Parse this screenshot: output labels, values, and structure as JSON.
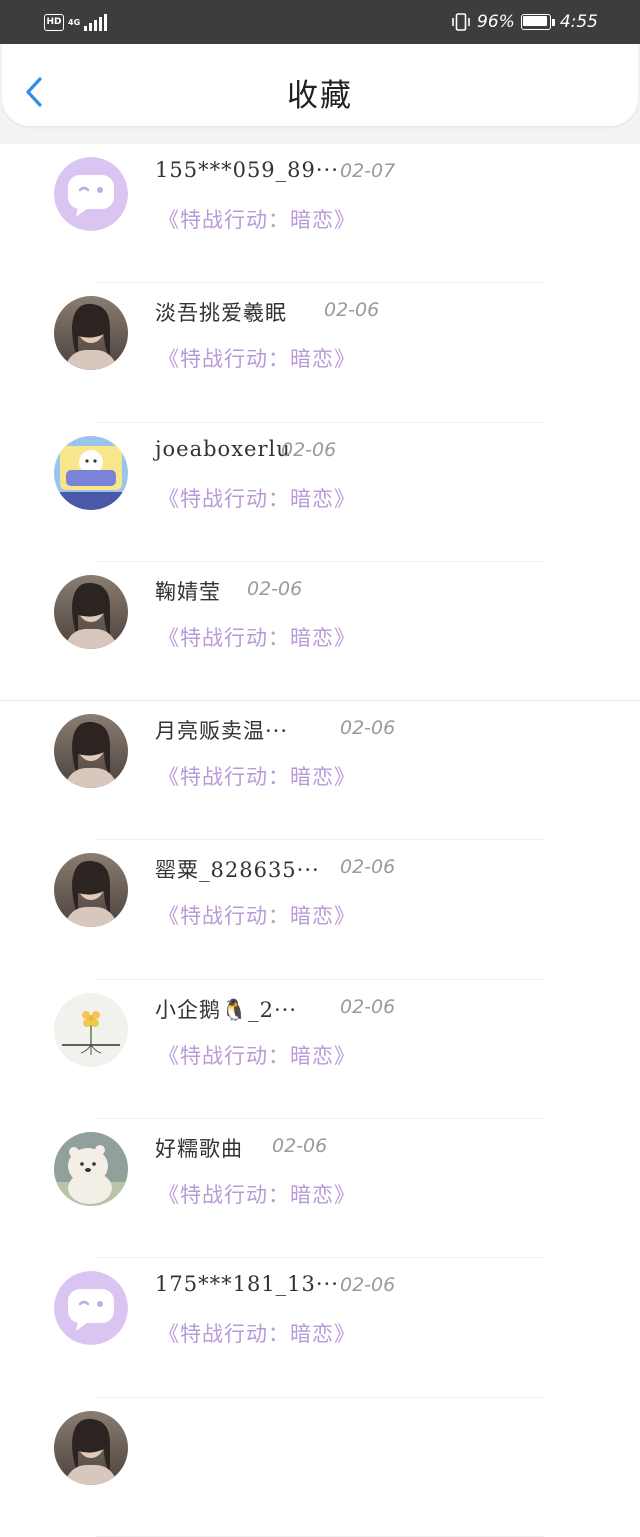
{
  "status_bar": {
    "hd": "HD",
    "network": "4G",
    "battery_percent": "96%",
    "battery_level": 0.96,
    "time": "4:55",
    "icons": [
      "signal-icon",
      "vibrate-icon",
      "battery-icon"
    ]
  },
  "header": {
    "title": "收藏",
    "back_icon": "chevron-left-icon",
    "accent_color": "#2f8fe8"
  },
  "book_title_color": "#b99ad8",
  "items": [
    {
      "username": "155***059_89···",
      "date": "02-07",
      "book": "《特战行动：暗恋》",
      "avatar": "default-avatar"
    },
    {
      "username": "淡吾挑爱羲眠",
      "date": "02-06",
      "book": "《特战行动：暗恋》",
      "avatar": "photo-avatar"
    },
    {
      "username": "joeaboxerlu",
      "date": "02-06",
      "book": "《特战行动：暗恋》",
      "avatar": "cartoon-avatar"
    },
    {
      "username": "鞠婧莹",
      "date": "02-06",
      "book": "《特战行动：暗恋》",
      "avatar": "photo-avatar"
    },
    {
      "username": "月亮贩卖温···",
      "date": "02-06",
      "book": "《特战行动：暗恋》",
      "avatar": "photo-avatar"
    },
    {
      "username": "罂粟_828635···",
      "date": "02-06",
      "book": "《特战行动：暗恋》",
      "avatar": "photo-avatar"
    },
    {
      "username": "小企鹅🐧_2···",
      "date": "02-06",
      "book": "《特战行动：暗恋》",
      "avatar": "flower-avatar"
    },
    {
      "username": "好糯歌曲",
      "date": "02-06",
      "book": "《特战行动：暗恋》",
      "avatar": "bear-avatar"
    },
    {
      "username": "175***181_13···",
      "date": "02-06",
      "book": "《特战行动：暗恋》",
      "avatar": "default-avatar"
    },
    {
      "username": "",
      "date": "",
      "book": "",
      "avatar": "photo-avatar"
    }
  ]
}
